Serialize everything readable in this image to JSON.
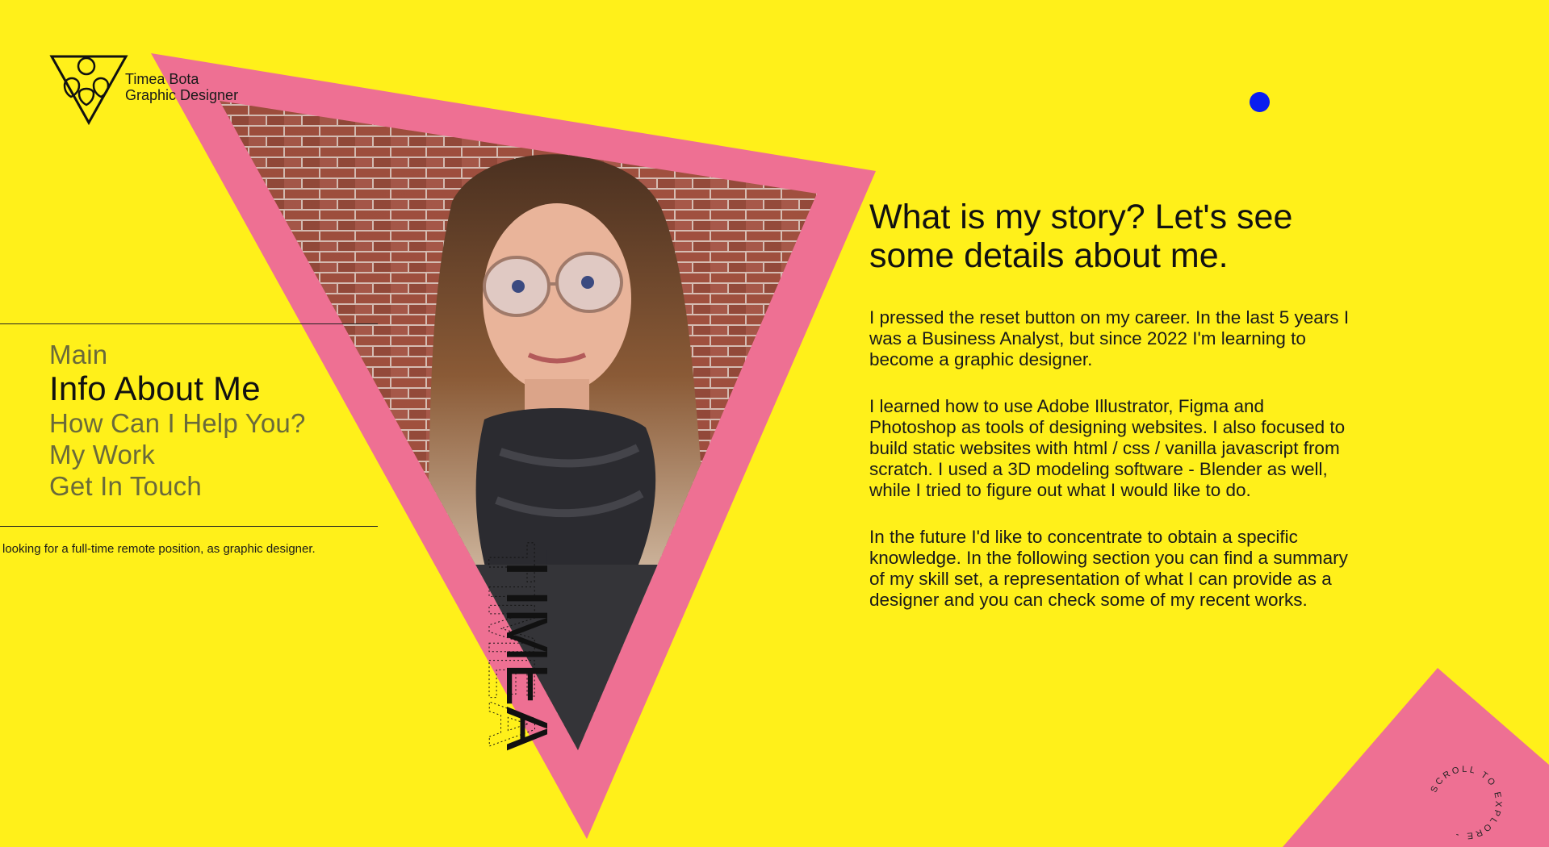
{
  "brand": {
    "name": "Timea Bota",
    "role": "Graphic Designer"
  },
  "nav": {
    "items": [
      {
        "label": "Main",
        "active": false
      },
      {
        "label": "Info About Me",
        "active": true
      },
      {
        "label": "How Can I Help You?",
        "active": false
      },
      {
        "label": "My Work",
        "active": false
      },
      {
        "label": "Get In Touch",
        "active": false
      }
    ]
  },
  "tagline": "looking for a full-time remote position, as graphic designer.",
  "rotated_name": "TIMEA",
  "story": {
    "title": "What is my story? Let's see some details about me.",
    "paragraphs": [
      "I pressed the reset button on my career. In the last 5 years I was a Business Analyst, but since 2022 I'm learning to become a graphic designer.",
      "I learned how to use Adobe Illustrator, Figma and Photoshop as tools of designing websites. I also focused to build static websites with html / css / vanilla javascript from scratch. I used a 3D modeling software - Blender as well, while I tried to figure out what I would like to do.",
      "In the future I'd like to concentrate to obtain a specific knowledge. In the following section you can find a summary of my skill set, a representation of what I can provide as a designer and you can check some of my recent works."
    ]
  },
  "scroll_hint": "SCROLL TO EXPLORE -",
  "colors": {
    "background": "#fff01a",
    "pink": "#ee7093",
    "blue_dot": "#0a1ef0",
    "text": "#111111",
    "nav_inactive": "#6a6a3a"
  },
  "icons": {
    "logo": "triangle-hearts-logo-icon",
    "dot": "blue-dot-icon"
  }
}
